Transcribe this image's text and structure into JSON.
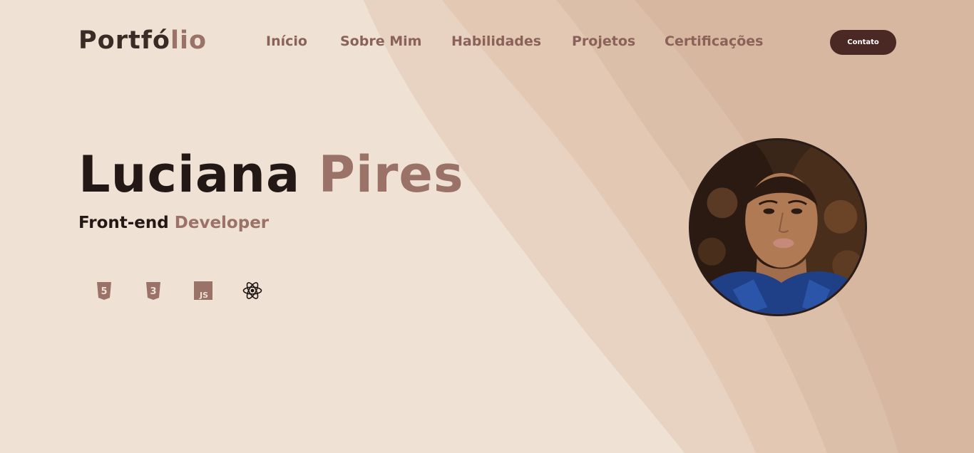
{
  "header": {
    "logo_main": "Portfó",
    "logo_accent": "lio",
    "nav": [
      {
        "label": "Início"
      },
      {
        "label": "Sobre Mim"
      },
      {
        "label": "Habilidades"
      },
      {
        "label": "Projetos"
      },
      {
        "label": "Certificações"
      }
    ],
    "contact_label": "Contato"
  },
  "hero": {
    "first_name": "Luciana",
    "last_name": "Pires",
    "role_main": "Front-end",
    "role_accent": "Developer"
  },
  "skills": [
    {
      "icon": "html5-icon",
      "badge": "5"
    },
    {
      "icon": "css3-icon",
      "badge": "3"
    },
    {
      "icon": "javascript-icon",
      "badge": "JS"
    },
    {
      "icon": "react-icon"
    }
  ],
  "colors": {
    "accent": "#9a7268",
    "dark_text": "#231816",
    "nav_text": "#8a6259",
    "button_bg": "#4a2824",
    "background": "#efe1d4"
  }
}
